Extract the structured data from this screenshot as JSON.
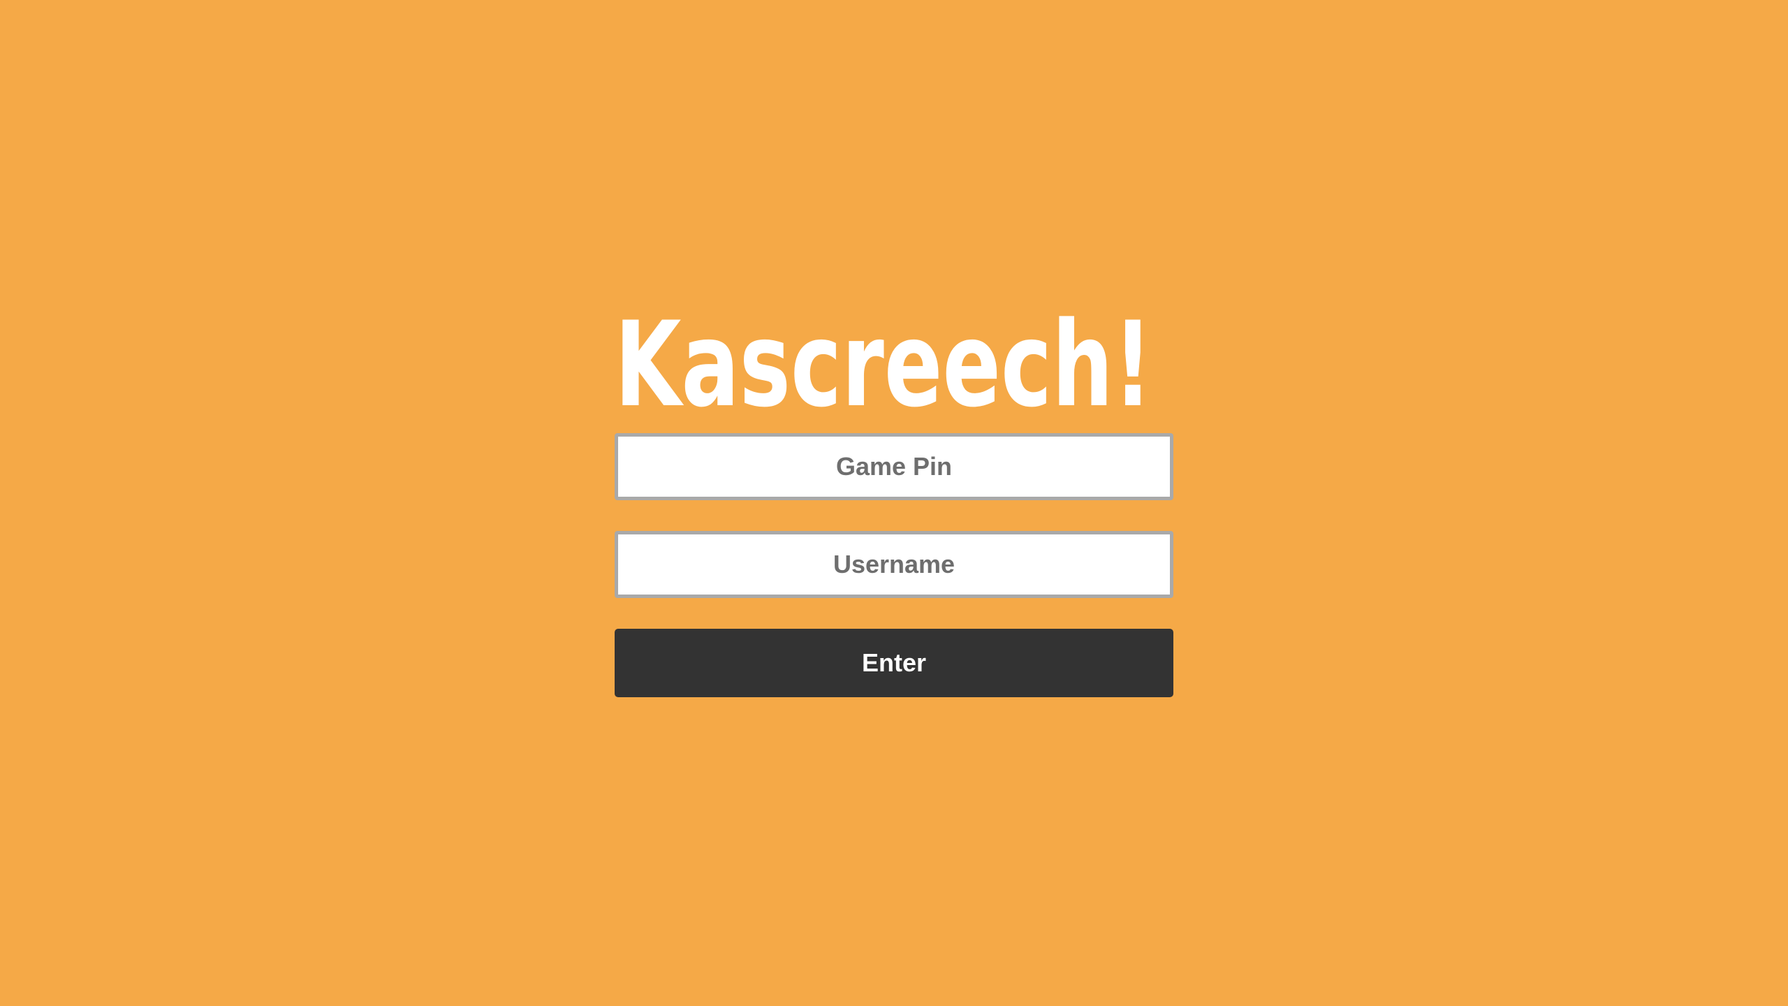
{
  "app": {
    "logo_text": "Kascreech!"
  },
  "form": {
    "game_pin_placeholder": "Game Pin",
    "username_placeholder": "Username",
    "enter_label": "Enter"
  },
  "colors": {
    "background": "#f5a947",
    "logo": "#ffffff",
    "button": "#333333",
    "button_text": "#ffffff",
    "input_border": "#a9a9a9"
  }
}
